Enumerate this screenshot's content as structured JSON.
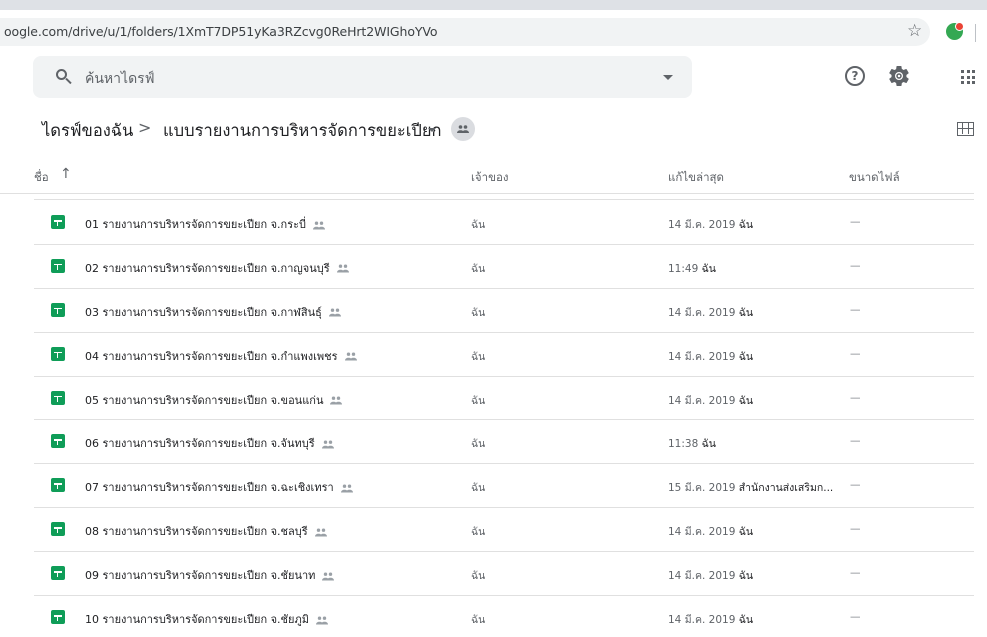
{
  "browser": {
    "url": "oogle.com/drive/u/1/folders/1XmT7DP51yKa3RZcvg0ReHrt2WIGhoYVo"
  },
  "search": {
    "placeholder": "ค้นหาไดรฟ์"
  },
  "breadcrumb": {
    "root": "ไดรฟ์ของฉัน",
    "separator": ">",
    "folder": "แบบรายงานการบริหารจัดการขยะเปียก"
  },
  "table": {
    "headers": {
      "name": "ชื่อ",
      "sort_arrow": "↑",
      "owner": "เจ้าของ",
      "modified": "แก้ไขล่าสุด",
      "size": "ขนาดไฟล์"
    },
    "rows": [
      {
        "name": "01 รายงานการบริหารจัดการขยะเปียก จ.กระบี่",
        "owner": "ฉัน",
        "modified": "14 มี.ค. 2019",
        "modified_by": "ฉัน",
        "size": "—"
      },
      {
        "name": "02 รายงานการบริหารจัดการขยะเปียก จ.กาญจนบุรี",
        "owner": "ฉัน",
        "modified": "11:49",
        "modified_by": "ฉัน",
        "size": "—"
      },
      {
        "name": "03 รายงานการบริหารจัดการขยะเปียก จ.กาฬสินธุ์",
        "owner": "ฉัน",
        "modified": "14 มี.ค. 2019",
        "modified_by": "ฉัน",
        "size": "—"
      },
      {
        "name": "04 รายงานการบริหารจัดการขยะเปียก จ.กำแพงเพชร",
        "owner": "ฉัน",
        "modified": "14 มี.ค. 2019",
        "modified_by": "ฉัน",
        "size": "—"
      },
      {
        "name": "05 รายงานการบริหารจัดการขยะเปียก จ.ขอนแก่น",
        "owner": "ฉัน",
        "modified": "14 มี.ค. 2019",
        "modified_by": "ฉัน",
        "size": "—"
      },
      {
        "name": "06 รายงานการบริหารจัดการขยะเปียก จ.จันทบุรี",
        "owner": "ฉัน",
        "modified": "11:38",
        "modified_by": "ฉัน",
        "size": "—"
      },
      {
        "name": "07 รายงานการบริหารจัดการขยะเปียก จ.ฉะเชิงเทรา",
        "owner": "ฉัน",
        "modified": "15 มี.ค. 2019",
        "modified_by": "สำนักงานส่งเสริมก...",
        "size": "—"
      },
      {
        "name": "08 รายงานการบริหารจัดการขยะเปียก จ.ชลบุรี",
        "owner": "ฉัน",
        "modified": "14 มี.ค. 2019",
        "modified_by": "ฉัน",
        "size": "—"
      },
      {
        "name": "09 รายงานการบริหารจัดการขยะเปียก จ.ชัยนาท",
        "owner": "ฉัน",
        "modified": "14 มี.ค. 2019",
        "modified_by": "ฉัน",
        "size": "—"
      },
      {
        "name": "10 รายงานการบริหารจัดการขยะเปียก จ.ชัยภูมิ",
        "owner": "ฉัน",
        "modified": "14 มี.ค. 2019",
        "modified_by": "ฉัน",
        "size": "—"
      }
    ]
  },
  "icons": {
    "file": "google-sheets-icon",
    "shared": "people-icon"
  },
  "colors": {
    "sheets_green": "#0f9d58",
    "search_bg": "#f1f3f4",
    "text_secondary": "#5f6368"
  }
}
